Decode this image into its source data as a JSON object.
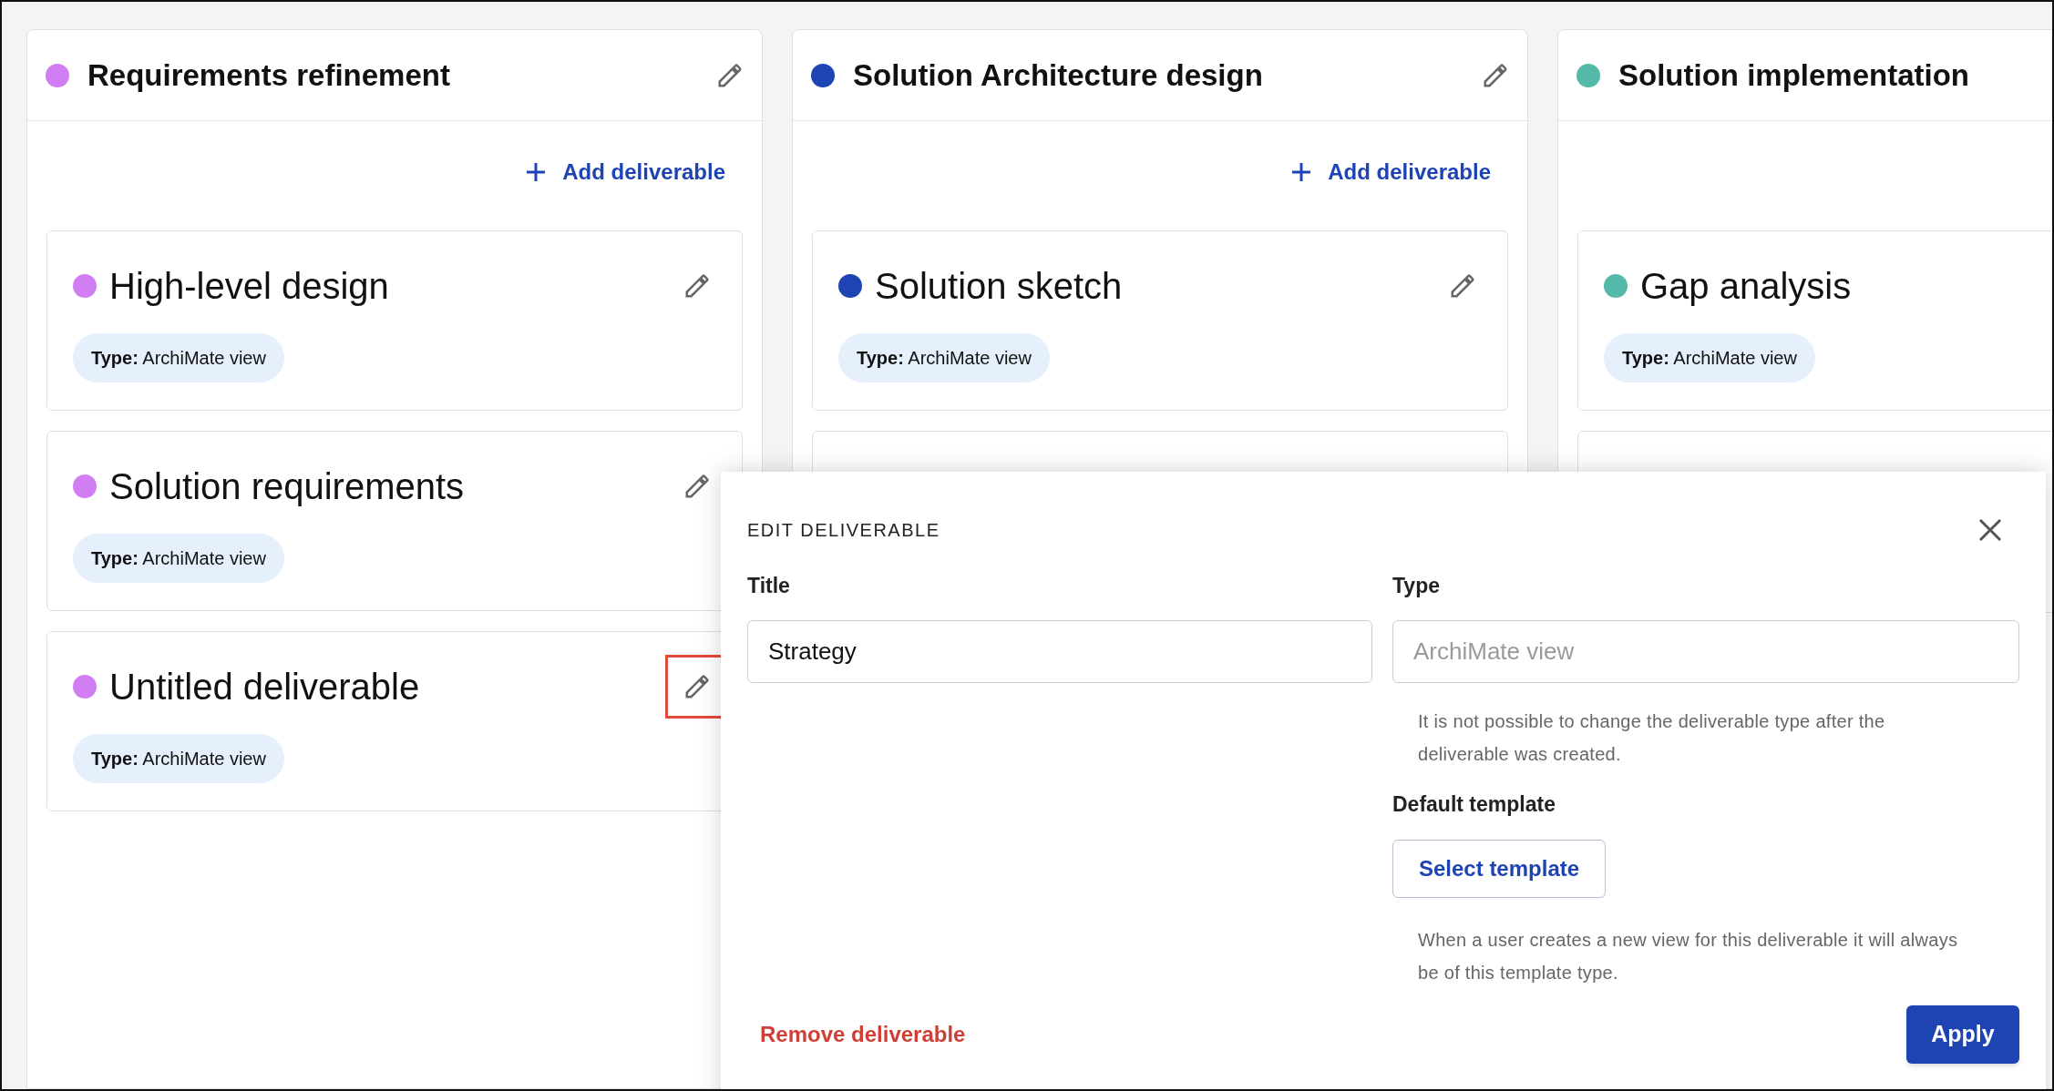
{
  "columns": [
    {
      "title": "Requirements refinement",
      "color": "#d07ef2",
      "add_label": "Add deliverable",
      "cards": [
        {
          "kind": "deliverable",
          "title": "High-level design",
          "type_label": "Type:",
          "type_value": "ArchiMate view",
          "highlighted": false
        },
        {
          "kind": "deliverable",
          "title": "Solution requirements",
          "type_label": "Type:",
          "type_value": "ArchiMate view",
          "highlighted": false
        },
        {
          "kind": "deliverable",
          "title": "Untitled deliverable",
          "type_label": "Type:",
          "type_value": "ArchiMate view",
          "highlighted": true
        }
      ]
    },
    {
      "title": "Solution Architecture design",
      "color": "#1e44b4",
      "add_label": "Add deliverable",
      "cards": [
        {
          "kind": "deliverable",
          "title": "Solution sketch",
          "type_label": "Type:",
          "type_value": "ArchiMate view",
          "highlighted": false
        },
        {
          "kind": "covered"
        }
      ]
    },
    {
      "title": "Solution implementation",
      "color": "#55b9aa",
      "cards": [
        {
          "kind": "deliverable",
          "title": "Gap analysis",
          "type_label": "Type:",
          "type_value": "ArchiMate view"
        },
        {
          "kind": "covered"
        }
      ]
    }
  ],
  "dialog": {
    "heading": "EDIT DELIVERABLE",
    "title_label": "Title",
    "title_value": "Strategy",
    "type_label": "Type",
    "type_placeholder": "ArchiMate view",
    "type_help": "It is not possible to change the deliverable type after the deliverable was created.",
    "template_label": "Default template",
    "template_button": "Select template",
    "template_help": "When a user creates a new view for this deliverable it will always be of this template type.",
    "remove_button": "Remove deliverable",
    "apply_button": "Apply"
  }
}
